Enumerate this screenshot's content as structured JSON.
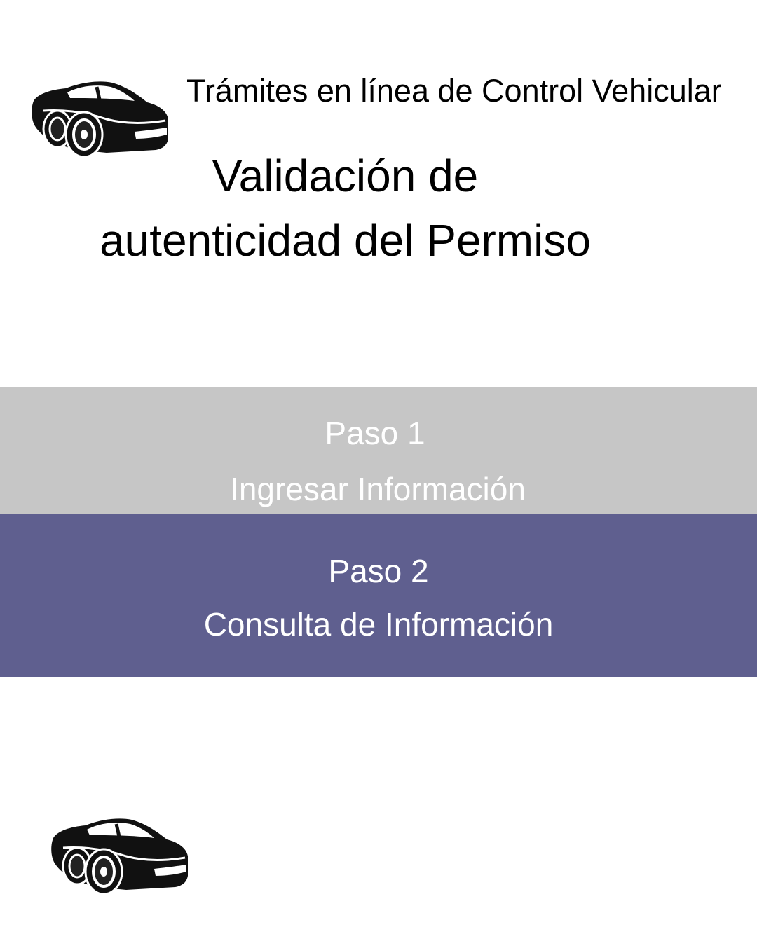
{
  "header": {
    "subtitle": "Trámites en línea de Control Vehicular",
    "title_line1": "Validación de",
    "title_line2": "autenticidad del Permiso",
    "logo_icon": "car-icon"
  },
  "steps": [
    {
      "number_label": "Paso 1",
      "name": "Ingresar Información",
      "state": "inactive",
      "color": "#c6c6c6"
    },
    {
      "number_label": "Paso 2",
      "name": "Consulta de Información",
      "state": "active",
      "color": "#5f5f8f"
    }
  ],
  "footer": {
    "logo_icon": "car-icon"
  }
}
